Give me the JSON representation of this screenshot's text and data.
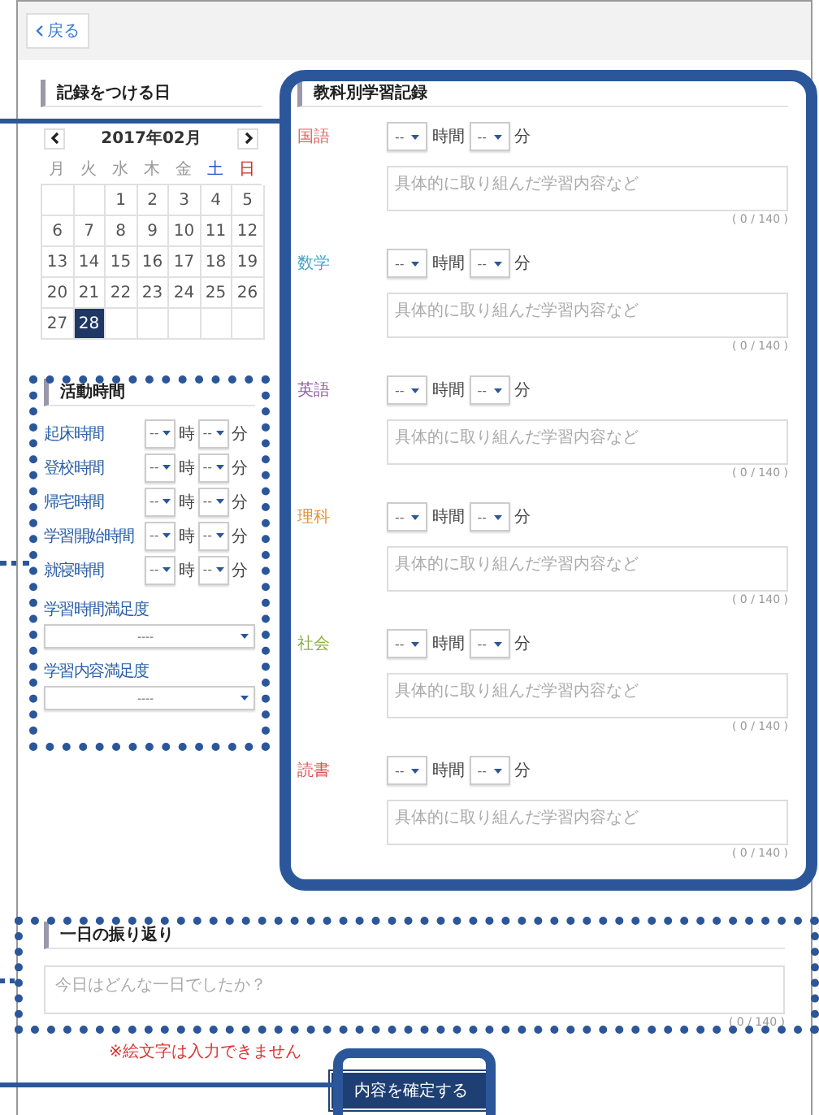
{
  "back_button": {
    "label": "戻る"
  },
  "record_day": {
    "title": "記録をつける日",
    "month": "2017年02月",
    "weekdays": [
      {
        "label": "月",
        "color": "#999999"
      },
      {
        "label": "火",
        "color": "#999999"
      },
      {
        "label": "水",
        "color": "#999999"
      },
      {
        "label": "木",
        "color": "#999999"
      },
      {
        "label": "金",
        "color": "#999999"
      },
      {
        "label": "土",
        "color": "#2255cc"
      },
      {
        "label": "日",
        "color": "#dd2222"
      }
    ],
    "weeks": [
      [
        {
          "kind": "blank"
        },
        {
          "kind": "blank"
        },
        {
          "kind": "day",
          "day": "1",
          "selected": false
        },
        {
          "kind": "day",
          "day": "2",
          "selected": false
        },
        {
          "kind": "day",
          "day": "3",
          "selected": false
        },
        {
          "kind": "day",
          "day": "4",
          "selected": false
        },
        {
          "kind": "day",
          "day": "5",
          "selected": false
        }
      ],
      [
        {
          "kind": "day",
          "day": "6",
          "selected": false
        },
        {
          "kind": "day",
          "day": "7",
          "selected": false
        },
        {
          "kind": "day",
          "day": "8",
          "selected": false
        },
        {
          "kind": "day",
          "day": "9",
          "selected": false
        },
        {
          "kind": "day",
          "day": "10",
          "selected": false
        },
        {
          "kind": "day",
          "day": "11",
          "selected": false
        },
        {
          "kind": "day",
          "day": "12",
          "selected": false
        }
      ],
      [
        {
          "kind": "day",
          "day": "13",
          "selected": false
        },
        {
          "kind": "day",
          "day": "14",
          "selected": false
        },
        {
          "kind": "day",
          "day": "15",
          "selected": false
        },
        {
          "kind": "day",
          "day": "16",
          "selected": false
        },
        {
          "kind": "day",
          "day": "17",
          "selected": false
        },
        {
          "kind": "day",
          "day": "18",
          "selected": false
        },
        {
          "kind": "day",
          "day": "19",
          "selected": false
        }
      ],
      [
        {
          "kind": "day",
          "day": "20",
          "selected": false
        },
        {
          "kind": "day",
          "day": "21",
          "selected": false
        },
        {
          "kind": "day",
          "day": "22",
          "selected": false
        },
        {
          "kind": "day",
          "day": "23",
          "selected": false
        },
        {
          "kind": "day",
          "day": "24",
          "selected": false
        },
        {
          "kind": "day",
          "day": "25",
          "selected": false
        },
        {
          "kind": "day",
          "day": "26",
          "selected": false
        }
      ],
      [
        {
          "kind": "day",
          "day": "27",
          "selected": false
        },
        {
          "kind": "day",
          "day": "28",
          "selected": true
        },
        {
          "kind": "blank"
        },
        {
          "kind": "blank"
        },
        {
          "kind": "blank"
        },
        {
          "kind": "blank"
        },
        {
          "kind": "blank"
        }
      ]
    ]
  },
  "activity": {
    "title": "活動時間",
    "rows": [
      {
        "label": "起床時間",
        "hour": "--",
        "hour_unit": "時",
        "minute": "--",
        "minute_unit": "分"
      },
      {
        "label": "登校時間",
        "hour": "--",
        "hour_unit": "時",
        "minute": "--",
        "minute_unit": "分"
      },
      {
        "label": "帰宅時間",
        "hour": "--",
        "hour_unit": "時",
        "minute": "--",
        "minute_unit": "分"
      },
      {
        "label": "学習開始時間",
        "hour": "--",
        "hour_unit": "時",
        "minute": "--",
        "minute_unit": "分"
      },
      {
        "label": "就寝時間",
        "hour": "--",
        "hour_unit": "時",
        "minute": "--",
        "minute_unit": "分"
      }
    ],
    "ratings": [
      {
        "label": "学習時間満足度",
        "value": "----"
      },
      {
        "label": "学習内容満足度",
        "value": "----"
      }
    ]
  },
  "subjects": {
    "title": "教科別学習記録",
    "items": [
      {
        "name": "国語",
        "color": "#e06666",
        "hour": "--",
        "hour_unit": "時間",
        "minute": "--",
        "minute_unit": "分",
        "placeholder": "具体的に取り組んだ学習内容など",
        "counter": "( 0 / 140 )"
      },
      {
        "name": "数学",
        "color": "#45a5c9",
        "hour": "--",
        "hour_unit": "時間",
        "minute": "--",
        "minute_unit": "分",
        "placeholder": "具体的に取り組んだ学習内容など",
        "counter": "( 0 / 140 )"
      },
      {
        "name": "英語",
        "color": "#8e5ea2",
        "hour": "--",
        "hour_unit": "時間",
        "minute": "--",
        "minute_unit": "分",
        "placeholder": "具体的に取り組んだ学習内容など",
        "counter": "( 0 / 140 )"
      },
      {
        "name": "理科",
        "color": "#e69138",
        "hour": "--",
        "hour_unit": "時間",
        "minute": "--",
        "minute_unit": "分",
        "placeholder": "具体的に取り組んだ学習内容など",
        "counter": "( 0 / 140 )"
      },
      {
        "name": "社会",
        "color": "#8bb04a",
        "hour": "--",
        "hour_unit": "時間",
        "minute": "--",
        "minute_unit": "分",
        "placeholder": "具体的に取り組んだ学習内容など",
        "counter": "( 0 / 140 )"
      },
      {
        "name": "読書",
        "color": "#d9534f",
        "hour": "--",
        "hour_unit": "時間",
        "minute": "--",
        "minute_unit": "分",
        "placeholder": "具体的に取り組んだ学習内容など",
        "counter": "( 0 / 140 )"
      }
    ]
  },
  "reflection": {
    "title": "一日の振り返り",
    "placeholder": "今日はどんな一日でしたか？",
    "counter": "( 0 / 140 )"
  },
  "note": "※絵文字は入力できません",
  "submit_button": {
    "label": "内容を確定する"
  }
}
